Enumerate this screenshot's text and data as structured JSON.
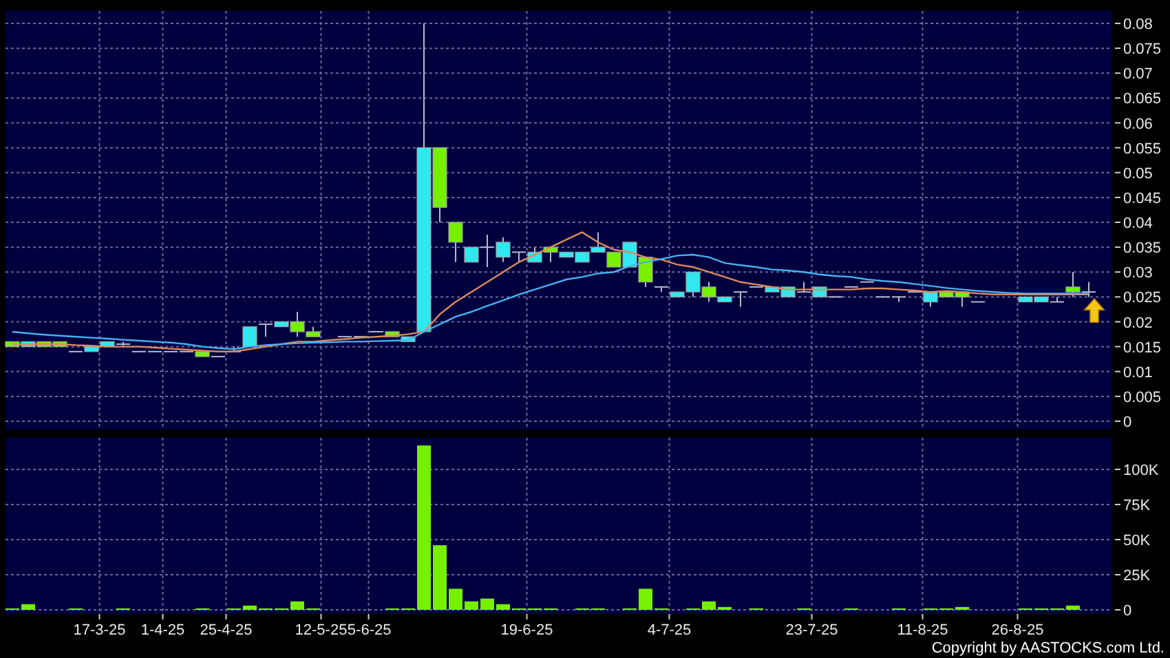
{
  "price_chart": {
    "chart_data": {
      "type": "candlestick",
      "grid": true,
      "categories": [
        null,
        null,
        null,
        null,
        null,
        null,
        null,
        null,
        null,
        null,
        null,
        null,
        null,
        null,
        null,
        null,
        null,
        null,
        null,
        null,
        null,
        null,
        null,
        null,
        null,
        null,
        null,
        null,
        null,
        null,
        null,
        null,
        null,
        null,
        null,
        null,
        null,
        null,
        null,
        null,
        null,
        null,
        null,
        null,
        null,
        null,
        null,
        null,
        null,
        null,
        null,
        null,
        null,
        null,
        null,
        null,
        null,
        null,
        null,
        null,
        null,
        null,
        null,
        null,
        null,
        null,
        null,
        null,
        null
      ],
      "ylim": [
        0,
        0.08
      ],
      "yticks": [
        {
          "value": 0,
          "label": "0"
        },
        {
          "value": 0.005,
          "label": "0.005"
        },
        {
          "value": 0.01,
          "label": "0.01"
        },
        {
          "value": 0.015,
          "label": "0.015"
        },
        {
          "value": 0.02,
          "label": "0.02"
        },
        {
          "value": 0.025,
          "label": "0.025"
        },
        {
          "value": 0.03,
          "label": "0.03"
        },
        {
          "value": 0.035,
          "label": "0.035"
        },
        {
          "value": 0.04,
          "label": "0.04"
        },
        {
          "value": 0.045,
          "label": "0.045"
        },
        {
          "value": 0.05,
          "label": "0.05"
        },
        {
          "value": 0.055,
          "label": "0.055"
        },
        {
          "value": 0.06,
          "label": "0.06"
        },
        {
          "value": 0.065,
          "label": "0.065"
        },
        {
          "value": 0.07,
          "label": "0.07"
        },
        {
          "value": 0.075,
          "label": "0.075"
        },
        {
          "value": 0.08,
          "label": "0.08"
        }
      ],
      "ohlc": [
        [
          0.016,
          0.016,
          0.015,
          0.015
        ],
        [
          0.015,
          0.016,
          0.015,
          0.016
        ],
        [
          0.016,
          0.016,
          0.015,
          0.015
        ],
        [
          0.016,
          0.016,
          0.015,
          0.015
        ],
        [
          0.014,
          0.014,
          0.014,
          0.014
        ],
        [
          0.014,
          0.015,
          0.014,
          0.015
        ],
        [
          0.015,
          0.016,
          0.015,
          0.016
        ],
        [
          0.0155,
          0.016,
          0.015,
          0.0155
        ],
        [
          0.014,
          0.014,
          0.014,
          0.014
        ],
        [
          0.014,
          0.014,
          0.014,
          0.014
        ],
        [
          0.014,
          0.014,
          0.014,
          0.014
        ],
        [
          0.014,
          0.014,
          0.014,
          0.014
        ],
        [
          0.014,
          0.014,
          0.013,
          0.013
        ],
        [
          0.013,
          0.013,
          0.013,
          0.013
        ],
        [
          0.014,
          0.015,
          0.014,
          0.014
        ],
        [
          0.015,
          0.019,
          0.015,
          0.019
        ],
        [
          0.0195,
          0.0195,
          0.017,
          0.0195
        ],
        [
          0.019,
          0.02,
          0.019,
          0.02
        ],
        [
          0.02,
          0.022,
          0.017,
          0.018
        ],
        [
          0.018,
          0.019,
          0.017,
          0.017
        ],
        null,
        [
          0.017,
          0.017,
          0.017,
          0.017
        ],
        [
          0.017,
          0.017,
          0.017,
          0.017
        ],
        [
          0.018,
          0.018,
          0.018,
          0.018
        ],
        [
          0.018,
          0.018,
          0.017,
          0.017
        ],
        [
          0.016,
          0.017,
          0.016,
          0.017
        ],
        [
          0.018,
          0.08,
          0.018,
          0.055
        ],
        [
          0.055,
          0.055,
          0.04,
          0.043
        ],
        [
          0.04,
          0.04,
          0.032,
          0.036
        ],
        [
          0.032,
          0.035,
          0.032,
          0.035
        ],
        [
          0.035,
          0.0375,
          0.031,
          0.035
        ],
        [
          0.033,
          0.037,
          0.032,
          0.036
        ],
        [
          0.034,
          0.034,
          0.032,
          0.034
        ],
        [
          0.032,
          0.035,
          0.032,
          0.034
        ],
        [
          0.035,
          0.035,
          0.032,
          0.034
        ],
        [
          0.033,
          0.034,
          0.033,
          0.034
        ],
        [
          0.032,
          0.034,
          0.032,
          0.034
        ],
        [
          0.034,
          0.038,
          0.034,
          0.035
        ],
        [
          0.034,
          0.034,
          0.031,
          0.031
        ],
        [
          0.031,
          0.036,
          0.031,
          0.036
        ],
        [
          0.033,
          0.033,
          0.027,
          0.028
        ],
        [
          0.027,
          0.027,
          0.026,
          0.027
        ],
        [
          0.025,
          0.026,
          0.025,
          0.026
        ],
        [
          0.026,
          0.03,
          0.025,
          0.03
        ],
        [
          0.027,
          0.028,
          0.024,
          0.025
        ],
        [
          0.024,
          0.025,
          0.024,
          0.025
        ],
        [
          0.026,
          0.026,
          0.023,
          0.026
        ],
        [
          0.027,
          0.027,
          0.027,
          0.027
        ],
        [
          0.026,
          0.027,
          0.026,
          0.027
        ],
        [
          0.025,
          0.027,
          0.025,
          0.027
        ],
        [
          0.026,
          0.028,
          0.026,
          0.026
        ],
        [
          0.025,
          0.027,
          0.025,
          0.027
        ],
        [
          0.025,
          0.025,
          0.025,
          0.025
        ],
        [
          0.027,
          0.027,
          0.027,
          0.027
        ],
        [
          0.028,
          0.028,
          0.028,
          0.028
        ],
        [
          0.025,
          0.025,
          0.025,
          0.025
        ],
        [
          0.025,
          0.025,
          0.024,
          0.025
        ],
        [
          0.026,
          0.026,
          0.026,
          0.026
        ],
        [
          0.024,
          0.026,
          0.023,
          0.026
        ],
        [
          0.026,
          0.026,
          0.025,
          0.025
        ],
        [
          0.026,
          0.026,
          0.023,
          0.025
        ],
        [
          0.024,
          0.024,
          0.024,
          0.024
        ],
        null,
        null,
        [
          0.024,
          0.025,
          0.024,
          0.025
        ],
        [
          0.024,
          0.025,
          0.024,
          0.025
        ],
        [
          0.024,
          0.025,
          0.024,
          0.024
        ],
        [
          0.027,
          0.03,
          0.025,
          0.026
        ],
        [
          0.026,
          0.028,
          0.025,
          0.026
        ]
      ],
      "series": [
        {
          "type": "line",
          "color": "#e08a5c",
          "values": [
            0.0155,
            0.0155,
            0.0155,
            0.0155,
            0.0153,
            0.0152,
            0.015,
            0.015,
            0.015,
            0.0148,
            0.0146,
            0.0144,
            0.0142,
            0.014,
            0.014,
            0.0145,
            0.015,
            0.0155,
            0.016,
            0.016,
            0.0163,
            0.0165,
            0.0168,
            0.017,
            0.0172,
            0.0175,
            0.018,
            0.0215,
            0.024,
            0.026,
            0.028,
            0.03,
            0.032,
            0.0335,
            0.035,
            0.0365,
            0.038,
            0.036,
            0.0345,
            0.034,
            0.033,
            0.0325,
            0.0315,
            0.031,
            0.03,
            0.029,
            0.028,
            0.0275,
            0.027,
            0.0265,
            0.0265,
            0.0265,
            0.0265,
            0.0265,
            0.0267,
            0.0267,
            0.0265,
            0.0263,
            0.026,
            0.0262,
            0.026,
            0.0257,
            0.0255,
            0.0255,
            0.0255,
            0.0255,
            0.0255,
            0.0255,
            0.0255
          ]
        },
        {
          "type": "line",
          "color": "#4ab0f0",
          "values": [
            0.018,
            0.0177,
            0.0174,
            0.0172,
            0.017,
            0.0168,
            0.0166,
            0.0164,
            0.0162,
            0.016,
            0.0158,
            0.0155,
            0.015,
            0.0147,
            0.0145,
            0.015,
            0.0153,
            0.0155,
            0.0157,
            0.0158,
            0.0159,
            0.016,
            0.016,
            0.0161,
            0.0162,
            0.0163,
            0.018,
            0.0195,
            0.021,
            0.022,
            0.0232,
            0.0243,
            0.0255,
            0.0265,
            0.0275,
            0.0285,
            0.029,
            0.0297,
            0.03,
            0.0312,
            0.032,
            0.0326,
            0.0333,
            0.0335,
            0.033,
            0.0318,
            0.0314,
            0.031,
            0.0305,
            0.0303,
            0.03,
            0.0295,
            0.0292,
            0.029,
            0.0285,
            0.0282,
            0.028,
            0.0276,
            0.0272,
            0.0268,
            0.0265,
            0.0262,
            0.026,
            0.0258,
            0.0257,
            0.0257,
            0.0257,
            0.0257,
            0.0257
          ]
        }
      ]
    }
  },
  "volume_chart": {
    "chart_data": {
      "type": "bar",
      "grid": true,
      "categories": [
        null,
        null,
        null,
        null,
        null,
        null,
        "17-3-25",
        null,
        null,
        null,
        "1-4-25",
        null,
        null,
        null,
        "25-4-25",
        null,
        null,
        null,
        null,
        null,
        "12-5-25",
        null,
        null,
        "5-6-25",
        null,
        null,
        null,
        null,
        null,
        null,
        null,
        null,
        null,
        "19-6-25",
        null,
        null,
        null,
        null,
        null,
        null,
        null,
        null,
        "4-7-25",
        null,
        null,
        null,
        null,
        null,
        null,
        null,
        null,
        "23-7-25",
        null,
        null,
        null,
        null,
        null,
        null,
        "11-8-25",
        null,
        null,
        null,
        null,
        null,
        "26-8-25",
        null,
        null,
        null,
        null
      ],
      "ylim": [
        0,
        122500
      ],
      "yticks": [
        {
          "value": 0,
          "label": "0"
        },
        {
          "value": 25000,
          "label": "25K"
        },
        {
          "value": 50000,
          "label": "50K"
        },
        {
          "value": 75000,
          "label": "75K"
        },
        {
          "value": 100000,
          "label": "100K"
        }
      ],
      "series": [
        {
          "color": "#77f000",
          "values": [
            1000,
            4000,
            0,
            0,
            1000,
            0,
            0,
            1000,
            0,
            0,
            0,
            0,
            1000,
            0,
            1000,
            3000,
            1000,
            1000,
            6000,
            1000,
            null,
            0,
            0,
            0,
            1000,
            1000,
            117000,
            46000,
            15000,
            6000,
            8000,
            4000,
            1000,
            1000,
            1000,
            0,
            1000,
            1000,
            0,
            1000,
            15000,
            1000,
            0,
            1000,
            6000,
            2000,
            0,
            1000,
            0,
            0,
            1000,
            0,
            0,
            1000,
            0,
            0,
            1000,
            0,
            1000,
            1000,
            2000,
            0,
            null,
            null,
            1000,
            1000,
            1000,
            3000,
            0
          ]
        }
      ]
    }
  },
  "copyright": "Copyright by AASTOCKS.com Ltd."
}
